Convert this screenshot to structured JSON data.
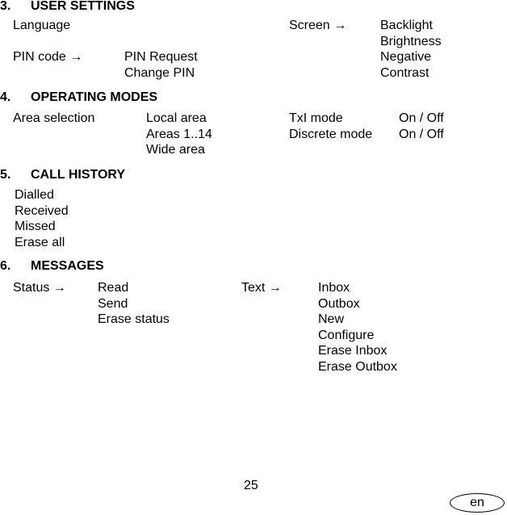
{
  "sections": [
    {
      "number": "3.",
      "title": "USER SETTINGS",
      "language": "Language",
      "pin_code": "PIN code →",
      "pin_items": [
        "PIN Request",
        "Change PIN"
      ],
      "screen": "Screen →",
      "screen_items": [
        "Backlight",
        "Brightness",
        "Negative",
        "Contrast"
      ]
    },
    {
      "number": "4.",
      "title": "OPERATING MODES",
      "area_selection": "Area selection",
      "area_items": [
        "Local area",
        "Areas 1..14",
        "Wide area"
      ],
      "modes": [
        {
          "name": "TxI mode",
          "value": "On / Off"
        },
        {
          "name": "Discrete mode",
          "value": "On / Off"
        }
      ]
    },
    {
      "number": "5.",
      "title": "CALL HISTORY",
      "items": [
        "Dialled",
        "Received",
        "Missed",
        "Erase all"
      ]
    },
    {
      "number": "6.",
      "title": "MESSAGES",
      "status": "Status →",
      "status_items": [
        "Read",
        "Send",
        "Erase status"
      ],
      "text": "Text →",
      "text_items": [
        "Inbox",
        "Outbox",
        "New",
        "Configure",
        "Erase Inbox",
        "Erase Outbox"
      ]
    }
  ],
  "footer": {
    "page_number": "25",
    "language_badge": "en"
  }
}
